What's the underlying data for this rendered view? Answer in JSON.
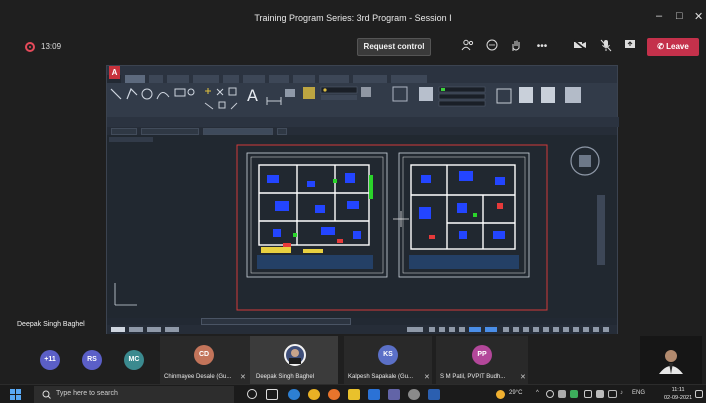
{
  "window": {
    "title": "Training Program Series: 3rd Program - Session I",
    "minimize_icon": "minimize-icon",
    "maximize_icon": "maximize-icon",
    "close_icon": "close-icon"
  },
  "meeting": {
    "elapsed": "13:09",
    "request_control_label": "Request control",
    "leave_label": "Leave",
    "controls": [
      "participants-icon",
      "chat-icon",
      "raise-hand-icon",
      "more-icon",
      "camera-off-icon",
      "mic-off-icon",
      "share-tray-icon"
    ],
    "leave_color": "#c4314b"
  },
  "presenter": {
    "name": "Deepak Singh Baghel"
  },
  "participants": {
    "overflow": "+11",
    "items": [
      {
        "initials": "RS",
        "color": "#5b5fc7"
      },
      {
        "initials": "MC",
        "color": "#3b8a8f"
      },
      {
        "initials": "CD",
        "color": "#c3745a",
        "name": "Chinmayee Desale (Gu..."
      },
      {
        "initials": "",
        "color": "#3f4f7a",
        "name": "Deepak Singh Baghel"
      },
      {
        "initials": "KS",
        "color": "#5b70c7",
        "name": "Kalpesh Sapakale (Gu..."
      },
      {
        "initials": "PP",
        "color": "#b3479a",
        "name": "S M Patil, PVPIT Budh..."
      }
    ]
  },
  "taskbar": {
    "search_placeholder": "Type here to search",
    "weather": "29°C",
    "language": "ENG",
    "time": "11:11",
    "date": "02-09-2021"
  }
}
